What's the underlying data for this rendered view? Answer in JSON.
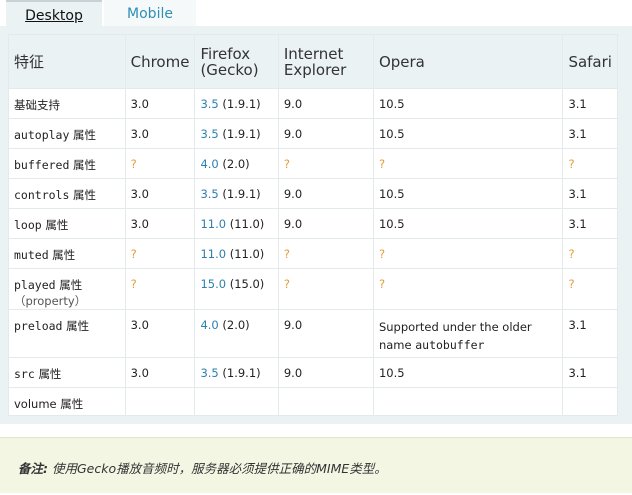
{
  "tabs": {
    "desktop": "Desktop",
    "mobile": "Mobile"
  },
  "table": {
    "headers": {
      "feature": "特征",
      "chrome": "Chrome",
      "firefox_1": "Firefox",
      "firefox_2": "(Gecko)",
      "ie_1": "Internet",
      "ie_2": "Explorer",
      "opera": "Opera",
      "safari": "Safari"
    },
    "attr_suffix": "属性",
    "rows": [
      {
        "feature_text": "基础支持",
        "chrome": "3.0",
        "ff_link": "3.5",
        "ff_ver": "(1.9.1)",
        "ie": "9.0",
        "opera": "10.5",
        "safari": "3.1"
      },
      {
        "feature_code": "autoplay",
        "chrome": "3.0",
        "ff_link": "3.5",
        "ff_ver": "(1.9.1)",
        "ie": "9.0",
        "opera": "10.5",
        "safari": "3.1"
      },
      {
        "feature_code": "buffered",
        "chrome": "?",
        "ff_link": "4.0",
        "ff_ver": "(2.0)",
        "ie": "?",
        "opera": "?",
        "safari": "?"
      },
      {
        "feature_code": "controls",
        "chrome": "3.0",
        "ff_link": "3.5",
        "ff_ver": "(1.9.1)",
        "ie": "9.0",
        "opera": "10.5",
        "safari": "3.1"
      },
      {
        "feature_code": "loop",
        "chrome": "3.0",
        "ff_link": "11.0",
        "ff_ver": "(11.0)",
        "ie": "9.0",
        "opera": "10.5",
        "safari": "3.1"
      },
      {
        "feature_code": "muted",
        "chrome": "?",
        "ff_link": "11.0",
        "ff_ver": "(11.0)",
        "ie": "?",
        "opera": "?",
        "safari": "?"
      },
      {
        "feature_code": "played",
        "feature_sub": "（property）",
        "chrome": "?",
        "ff_link": "15.0",
        "ff_ver": "(15.0)",
        "ie": "?",
        "opera": "?",
        "safari": "?"
      },
      {
        "feature_code": "preload",
        "chrome": "3.0",
        "ff_link": "4.0",
        "ff_ver": "(2.0)",
        "ie": "9.0",
        "opera_line1": "Supported under the older",
        "opera_line2_text": "name",
        "opera_line2_code": "autobuffer",
        "safari": "3.1"
      },
      {
        "feature_code": "src",
        "chrome": "3.0",
        "ff_link": "3.5",
        "ff_ver": "(1.9.1)",
        "ie": "9.0",
        "opera": "10.5",
        "safari": "3.1"
      },
      {
        "feature_text": "volume 属性"
      }
    ]
  },
  "note": {
    "label": "备注:",
    "text": "使用Gecko播放音频时，服务器必须提供正确的MIME类型。"
  },
  "colors": {
    "panel": "#eaf2f4",
    "link": "#2f7fb0",
    "question": "#e39b3a",
    "note_bg": "#f4f6e4"
  }
}
